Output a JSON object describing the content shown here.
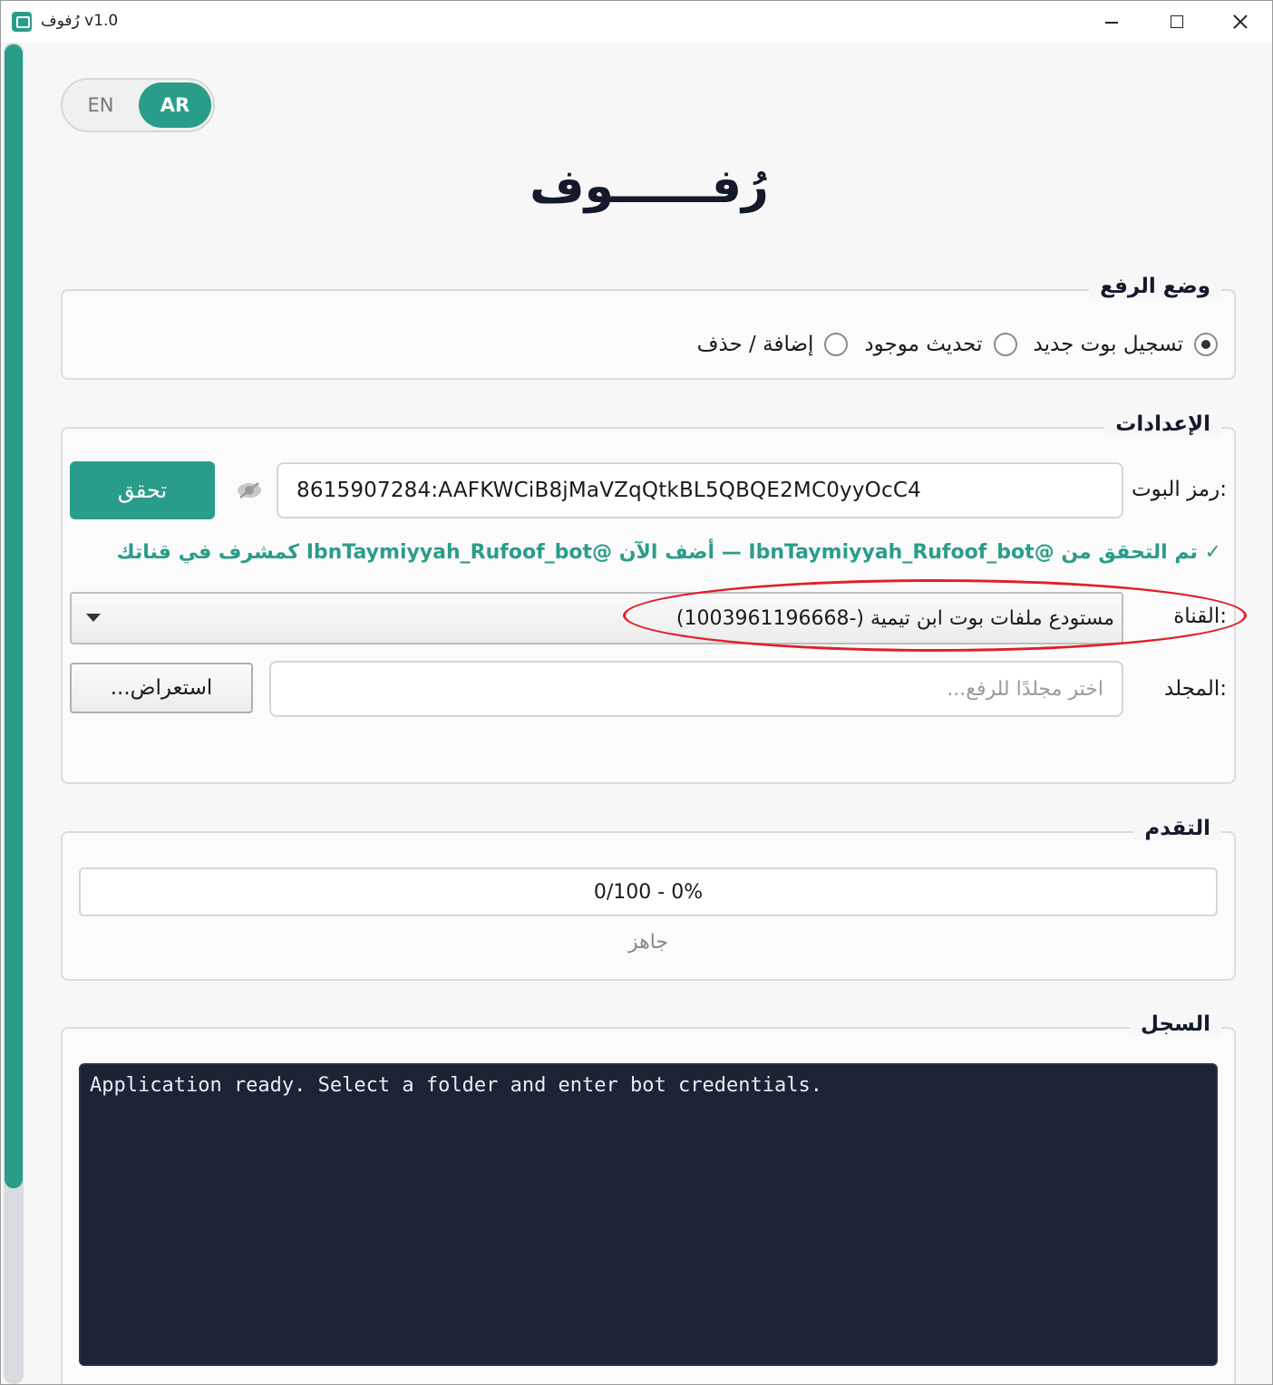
{
  "window": {
    "title": "رُفوف v1.0",
    "controls": [
      "minimize",
      "maximize",
      "close"
    ]
  },
  "language_toggle": {
    "options": [
      "EN",
      "AR"
    ],
    "selected": "AR"
  },
  "app": {
    "title": "رُفــــــوف"
  },
  "upload_mode": {
    "title": "وضع الرفع",
    "options": [
      {
        "label": "تسجيل بوت جديد",
        "checked": true
      },
      {
        "label": "تحديث موجود",
        "checked": false
      },
      {
        "label": "إضافة / حذف",
        "checked": false
      }
    ]
  },
  "settings": {
    "title": "الإعدادات",
    "bot_token_label": "رمز البوت:",
    "bot_token_value": "8615907284:AAFKWCiB8jMaVZqQtkBL5QBQE2MC0yyOcC4",
    "verify_button": "تحقق",
    "verified_message": "✓ تم التحقق من @IbnTaymiyyah_Rufoof_bot — أضف الآن @IbnTaymiyyah_Rufoof_bot كمشرف في قناتك",
    "channel_label": "القناة:",
    "channel_value": "مستودع ملفات بوت ابن تيمية  (-1003961196668)",
    "folder_label": "المجلد:",
    "folder_placeholder": "اختر مجلدًا للرفع...",
    "browse_button": "استعراض..."
  },
  "progress": {
    "title": "التقدم",
    "text": "0/100 - 0%",
    "fraction": 0.0,
    "status": "جاهز"
  },
  "log": {
    "title": "السجل",
    "content": "Application ready. Select a folder and enter bot credentials."
  },
  "colors": {
    "accent": "#2a9d8a",
    "log_background": "#1c2333",
    "annotation": "#e0202a"
  }
}
